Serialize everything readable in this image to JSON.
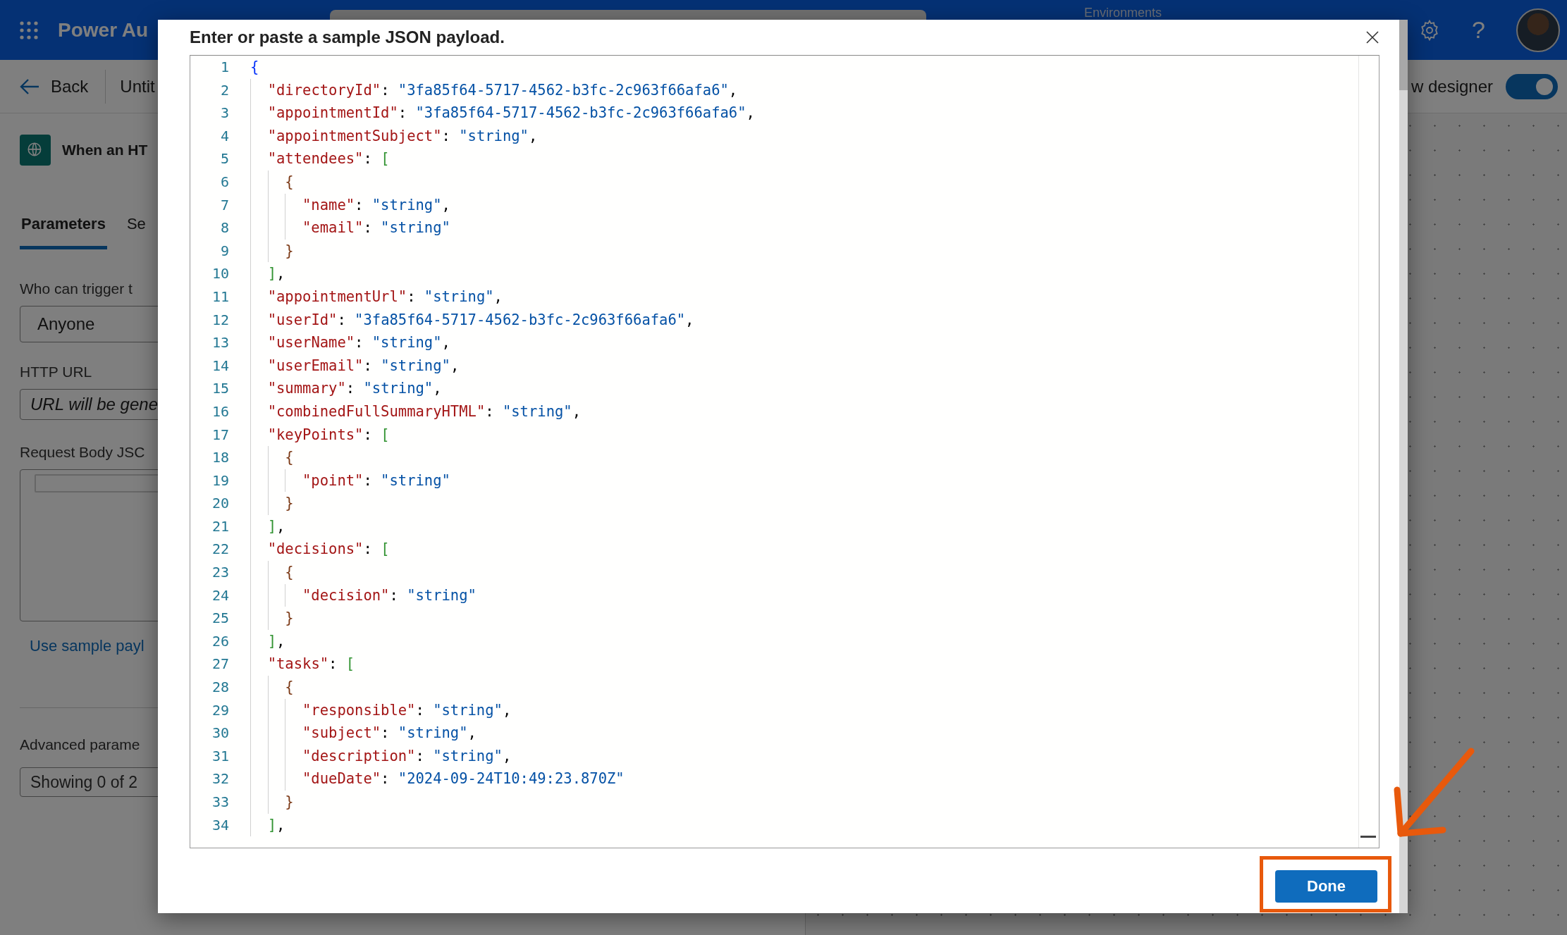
{
  "top_bar": {
    "app_name": "Power Au",
    "environment_label": "Environments",
    "help": "?"
  },
  "toolbar": {
    "back": "Back",
    "flow_name": "Untit",
    "designer_toggle": {
      "label": "w designer",
      "on": true
    }
  },
  "trigger_panel": {
    "title": "When an HT",
    "tabs": [
      {
        "label": "Parameters",
        "selected": true
      },
      {
        "label": "Se",
        "selected": false
      }
    ],
    "fields": [
      {
        "kind": "dropdown",
        "label": "Who can trigger t",
        "value": "Anyone"
      },
      {
        "kind": "text",
        "label": "HTTP URL",
        "placeholder": "URL will be gene"
      },
      {
        "kind": "textarea",
        "label": "Request Body JSC"
      }
    ],
    "sample_link": "Use sample payl",
    "advanced": {
      "label": "Advanced parame",
      "value": "Showing 0 of 2"
    }
  },
  "dialog": {
    "title": "Enter or paste a sample JSON payload.",
    "lines": [
      {
        "number": "1",
        "code": "{"
      },
      {
        "number": "2",
        "code": "  \"directoryId\": \"3fa85f64-5717-4562-b3fc-2c963f66afa6\","
      },
      {
        "number": "3",
        "code": "  \"appointmentId\": \"3fa85f64-5717-4562-b3fc-2c963f66afa6\","
      },
      {
        "number": "4",
        "code": "  \"appointmentSubject\": \"string\","
      },
      {
        "number": "5",
        "code": "  \"attendees\": ["
      },
      {
        "number": "6",
        "code": "    {"
      },
      {
        "number": "7",
        "code": "      \"name\": \"string\","
      },
      {
        "number": "8",
        "code": "      \"email\": \"string\""
      },
      {
        "number": "9",
        "code": "    }"
      },
      {
        "number": "10",
        "code": "  ],"
      },
      {
        "number": "11",
        "code": "  \"appointmentUrl\": \"string\","
      },
      {
        "number": "12",
        "code": "  \"userId\": \"3fa85f64-5717-4562-b3fc-2c963f66afa6\","
      },
      {
        "number": "13",
        "code": "  \"userName\": \"string\","
      },
      {
        "number": "14",
        "code": "  \"userEmail\": \"string\","
      },
      {
        "number": "15",
        "code": "  \"summary\": \"string\","
      },
      {
        "number": "16",
        "code": "  \"combinedFullSummaryHTML\": \"string\","
      },
      {
        "number": "17",
        "code": "  \"keyPoints\": ["
      },
      {
        "number": "18",
        "code": "    {"
      },
      {
        "number": "19",
        "code": "      \"point\": \"string\""
      },
      {
        "number": "20",
        "code": "    }"
      },
      {
        "number": "21",
        "code": "  ],"
      },
      {
        "number": "22",
        "code": "  \"decisions\": ["
      },
      {
        "number": "23",
        "code": "    {"
      },
      {
        "number": "24",
        "code": "      \"decision\": \"string\""
      },
      {
        "number": "25",
        "code": "    }"
      },
      {
        "number": "26",
        "code": "  ],"
      },
      {
        "number": "27",
        "code": "  \"tasks\": ["
      },
      {
        "number": "28",
        "code": "    {"
      },
      {
        "number": "29",
        "code": "      \"responsible\": \"string\","
      },
      {
        "number": "30",
        "code": "      \"subject\": \"string\","
      },
      {
        "number": "31",
        "code": "      \"description\": \"string\","
      },
      {
        "number": "32",
        "code": "      \"dueDate\": \"2024-09-24T10:49:23.870Z\""
      },
      {
        "number": "33",
        "code": "    }"
      },
      {
        "number": "34",
        "code": "  ],"
      }
    ],
    "done_button": "Done"
  }
}
